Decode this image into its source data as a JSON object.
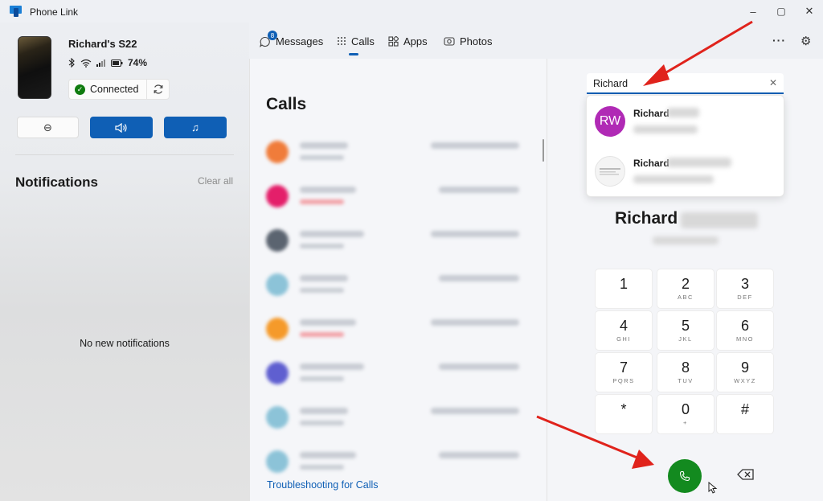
{
  "app": {
    "title": "Phone Link",
    "colors": {
      "accent": "#0f5fb5",
      "call_green": "#138a1f",
      "connected_green": "#0f7b0f",
      "avatar_purple": "#b02ab5",
      "annotation_red": "#e0231c"
    }
  },
  "window_controls": {
    "minimize": "–",
    "maximize": "▢",
    "close": "✕"
  },
  "device": {
    "name": "Richard's S22",
    "battery": "74%",
    "status_icons": [
      "bluetooth-icon",
      "wifi-icon",
      "signal-icon",
      "battery-icon"
    ],
    "connection_status": "Connected",
    "controls": {
      "dnd_icon": "⊖",
      "volume_icon": "🔊",
      "music_icon": "♫"
    }
  },
  "notifications": {
    "title": "Notifications",
    "clear_all": "Clear all",
    "empty_text": "No new notifications"
  },
  "nav": {
    "tabs": [
      {
        "label": "Messages",
        "icon": "messages-icon",
        "badge": "8"
      },
      {
        "label": "Calls",
        "icon": "dialpad-icon",
        "active": true
      },
      {
        "label": "Apps",
        "icon": "apps-icon"
      },
      {
        "label": "Photos",
        "icon": "photos-icon"
      }
    ],
    "more_icon": "···",
    "settings_icon": "⚙"
  },
  "calls": {
    "title": "Calls",
    "troubleshoot_link": "Troubleshooting for Calls"
  },
  "dialer": {
    "search_value": "Richard",
    "clear_icon": "✕",
    "suggestions": [
      {
        "initials": "RW",
        "name": "Richard"
      },
      {
        "initials": "",
        "name": "Richard"
      }
    ],
    "contact_first_name": "Richard",
    "keys": [
      {
        "digit": "1",
        "letters": ""
      },
      {
        "digit": "2",
        "letters": "ABC"
      },
      {
        "digit": "3",
        "letters": "DEF"
      },
      {
        "digit": "4",
        "letters": "GHI"
      },
      {
        "digit": "5",
        "letters": "JKL"
      },
      {
        "digit": "6",
        "letters": "MNO"
      },
      {
        "digit": "7",
        "letters": "PQRS"
      },
      {
        "digit": "8",
        "letters": "TUV"
      },
      {
        "digit": "9",
        "letters": "WXYZ"
      },
      {
        "digit": "*",
        "letters": ""
      },
      {
        "digit": "0",
        "letters": "+"
      },
      {
        "digit": "#",
        "letters": ""
      }
    ]
  }
}
